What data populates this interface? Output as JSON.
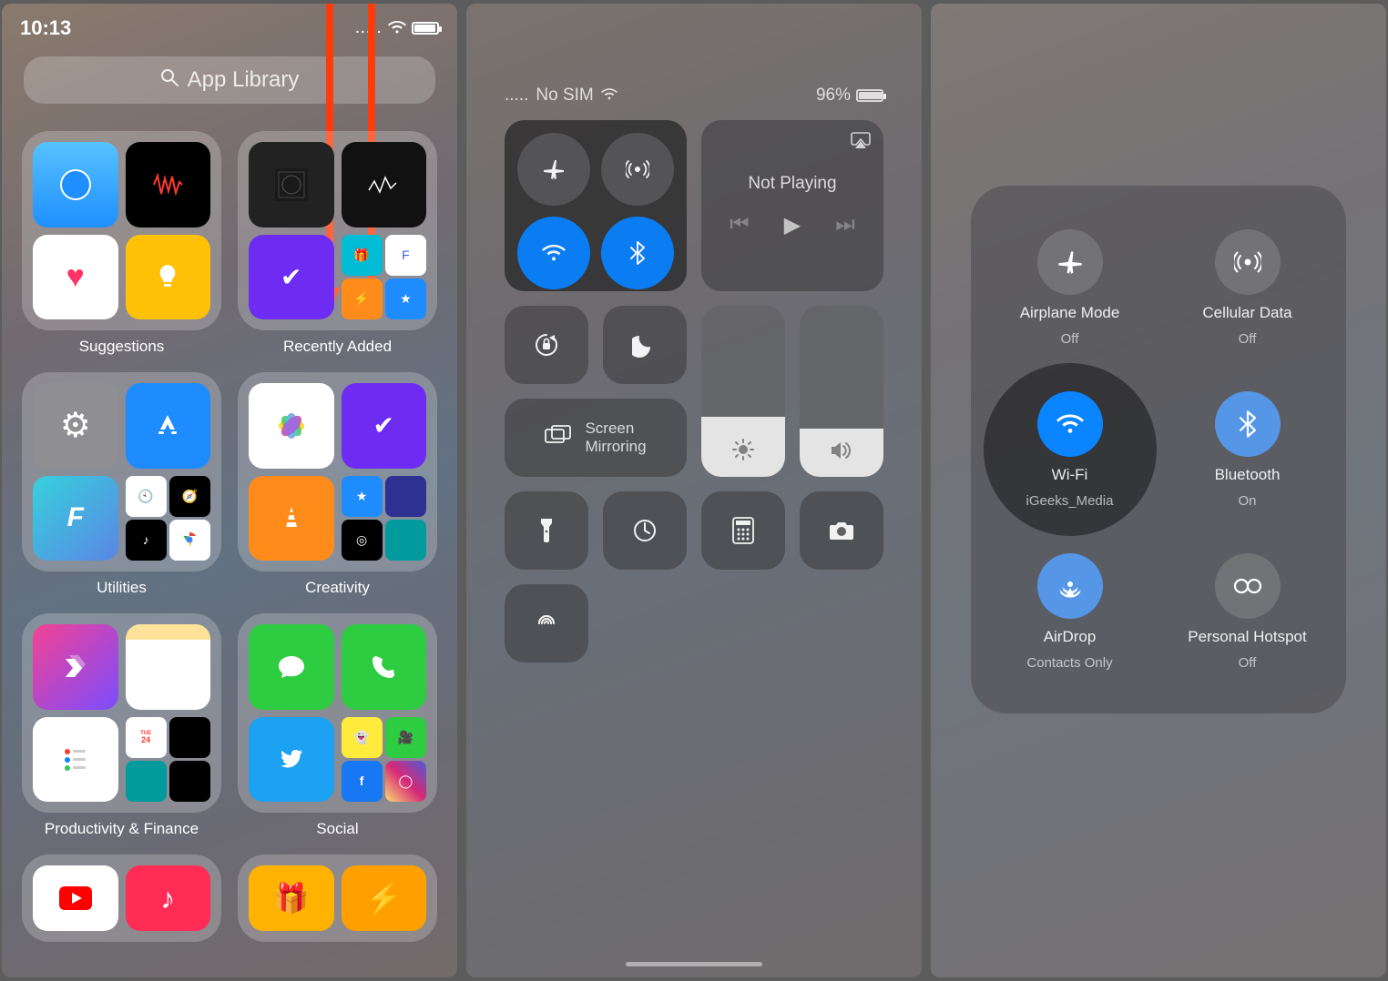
{
  "panel1": {
    "time": "10:13",
    "dots": ".....",
    "search_placeholder": "App Library",
    "folders": {
      "suggestions": "Suggestions",
      "recently_added": "Recently Added",
      "utilities": "Utilities",
      "creativity": "Creativity",
      "productivity": "Productivity & Finance",
      "social": "Social"
    }
  },
  "panel2": {
    "carrier_dots": ".....",
    "carrier": "No SIM",
    "battery_pct": "96%",
    "not_playing": "Not Playing",
    "screen_mirroring": "Screen\nMirroring",
    "connectivity": {
      "airplane": "off",
      "cellular": "off",
      "wifi": "on",
      "bluetooth": "on"
    }
  },
  "panel3": {
    "items": {
      "airplane": {
        "label": "Airplane Mode",
        "sub": "Off"
      },
      "cellular": {
        "label": "Cellular Data",
        "sub": "Off"
      },
      "wifi": {
        "label": "Wi-Fi",
        "sub": "iGeeks_Media"
      },
      "bluetooth": {
        "label": "Bluetooth",
        "sub": "On"
      },
      "airdrop": {
        "label": "AirDrop",
        "sub": "Contacts Only"
      },
      "hotspot": {
        "label": "Personal Hotspot",
        "sub": "Off"
      }
    }
  }
}
